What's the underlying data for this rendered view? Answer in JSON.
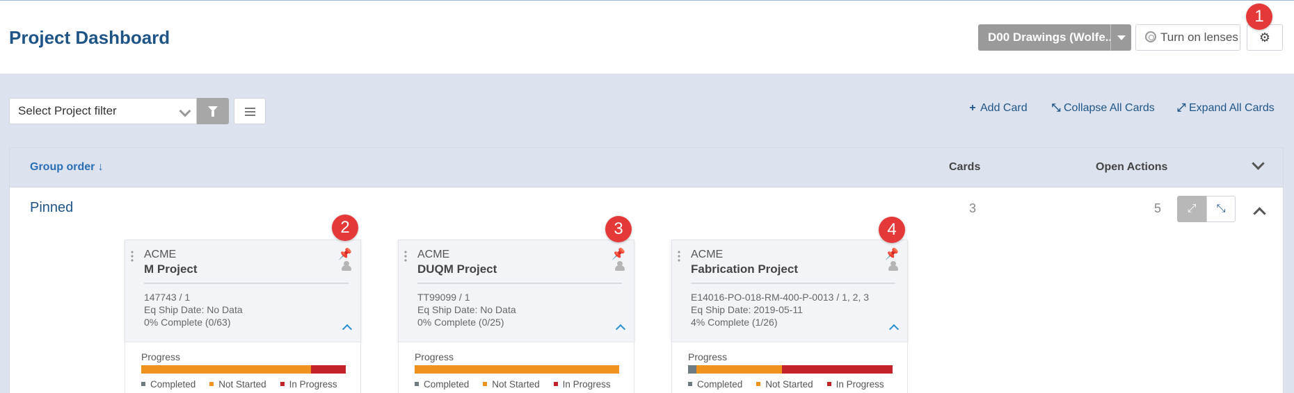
{
  "header": {
    "title": "Project Dashboard",
    "lens_selector": "D00 Drawings (Wolfe...",
    "turn_on_lenses": "Turn on lenses"
  },
  "badges": [
    "1",
    "2",
    "3",
    "4"
  ],
  "toolbar": {
    "filter_placeholder": "Select Project filter",
    "add_card": "Add Card",
    "collapse_all": "Collapse All Cards",
    "expand_all": "Expand All Cards"
  },
  "table": {
    "group_order": "Group order",
    "cards_col": "Cards",
    "open_actions_col": "Open Actions"
  },
  "group": {
    "label": "Pinned",
    "cards_count": "3",
    "open_actions_count": "5"
  },
  "colors": {
    "title": "#1f5486",
    "completed": "#6e7b80",
    "not_started": "#f0931e",
    "in_progress": "#c4222b",
    "badge": "#e53939"
  },
  "cards": [
    {
      "org": "ACME",
      "name": "M Project",
      "ref": "147743 / 1",
      "ship_date": "Eq Ship Date: No Data",
      "complete": "0% Complete (0/63)",
      "progress_label": "Progress",
      "progress": {
        "completed": 0,
        "not_started": 0.83,
        "in_progress": 0.17
      },
      "legend": [
        "Completed",
        "Not Started",
        "In Progress"
      ]
    },
    {
      "org": "ACME",
      "name": "DUQM Project",
      "ref": "TT99099 / 1",
      "ship_date": "Eq Ship Date: No Data",
      "complete": "0% Complete (0/25)",
      "progress_label": "Progress",
      "progress": {
        "completed": 0,
        "not_started": 1.0,
        "in_progress": 0
      },
      "legend": [
        "Completed",
        "Not Started",
        "In Progress"
      ]
    },
    {
      "org": "ACME",
      "name": "Fabrication Project",
      "ref": "E14016-PO-018-RM-400-P-0013 / 1, 2, 3",
      "ship_date": "Eq Ship Date: 2019-05-11",
      "complete": "4% Complete (1/26)",
      "progress_label": "Progress",
      "progress": {
        "completed": 0.04,
        "not_started": 0.42,
        "in_progress": 0.54
      },
      "legend": [
        "Completed",
        "Not Started",
        "In Progress"
      ]
    }
  ]
}
